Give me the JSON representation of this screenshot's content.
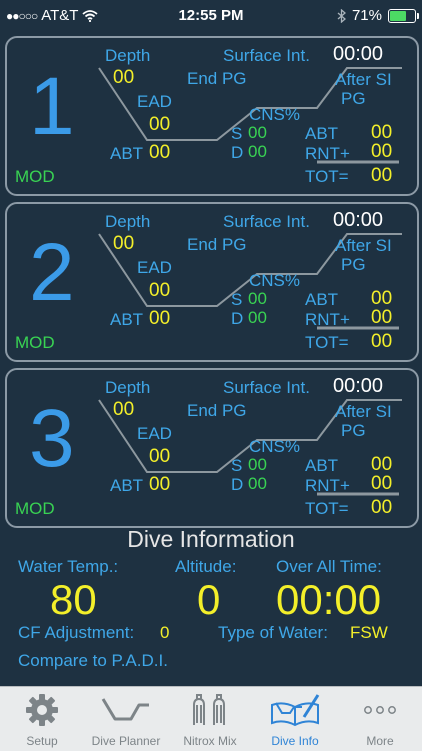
{
  "status_bar": {
    "carrier": "AT&T",
    "time": "12:55 PM",
    "battery": "71%",
    "battery_fraction": 0.71
  },
  "labels": {
    "depth": "Depth",
    "surface_int": "Surface Int.",
    "end_pg": "End PG",
    "after_si": "After SI",
    "pg": "PG",
    "ead": "EAD",
    "cns": "CNS%",
    "s": "S",
    "d": "D",
    "abt": "ABT",
    "rnt": "RNT+",
    "tot": "TOT=",
    "mod": "MOD"
  },
  "dives": [
    {
      "number": "1",
      "depth": "00",
      "surface_int": "00:00",
      "ead": "00",
      "abt_left": "00",
      "cns_s": "00",
      "cns_d": "00",
      "abt": "00",
      "rnt": "00",
      "tot": "00"
    },
    {
      "number": "2",
      "depth": "00",
      "surface_int": "00:00",
      "ead": "00",
      "abt_left": "00",
      "cns_s": "00",
      "cns_d": "00",
      "abt": "00",
      "rnt": "00",
      "tot": "00"
    },
    {
      "number": "3",
      "depth": "00",
      "surface_int": "00:00",
      "ead": "00",
      "abt_left": "00",
      "cns_s": "00",
      "cns_d": "00",
      "abt": "00",
      "rnt": "00",
      "tot": "00"
    }
  ],
  "dive_info": {
    "title": "Dive Information",
    "water_temp_label": "Water Temp.:",
    "water_temp": "80",
    "altitude_label": "Altitude:",
    "altitude": "0",
    "overall_label": "Over All Time:",
    "overall": "00:00",
    "cf_label": "CF Adjustment:",
    "cf": "0",
    "water_type_label": "Type of Water:",
    "water_type": "FSW",
    "compare": "Compare to P.A.D.I."
  },
  "tabs": [
    {
      "label": "Setup",
      "icon": "gear-icon",
      "active": false
    },
    {
      "label": "Dive Planner",
      "icon": "dive-profile-icon",
      "active": false
    },
    {
      "label": "Nitrox Mix",
      "icon": "tanks-icon",
      "active": false
    },
    {
      "label": "Dive Info",
      "icon": "logbook-icon",
      "active": true
    },
    {
      "label": "More",
      "icon": "more-icon",
      "active": false
    }
  ],
  "colors": {
    "background": "#1e3141",
    "label_blue": "#3fa7e8",
    "value_yellow": "#f3ef2a",
    "mod_green": "#39d353",
    "number_blue": "#3b9be8",
    "tab_active": "#2f84d6"
  }
}
